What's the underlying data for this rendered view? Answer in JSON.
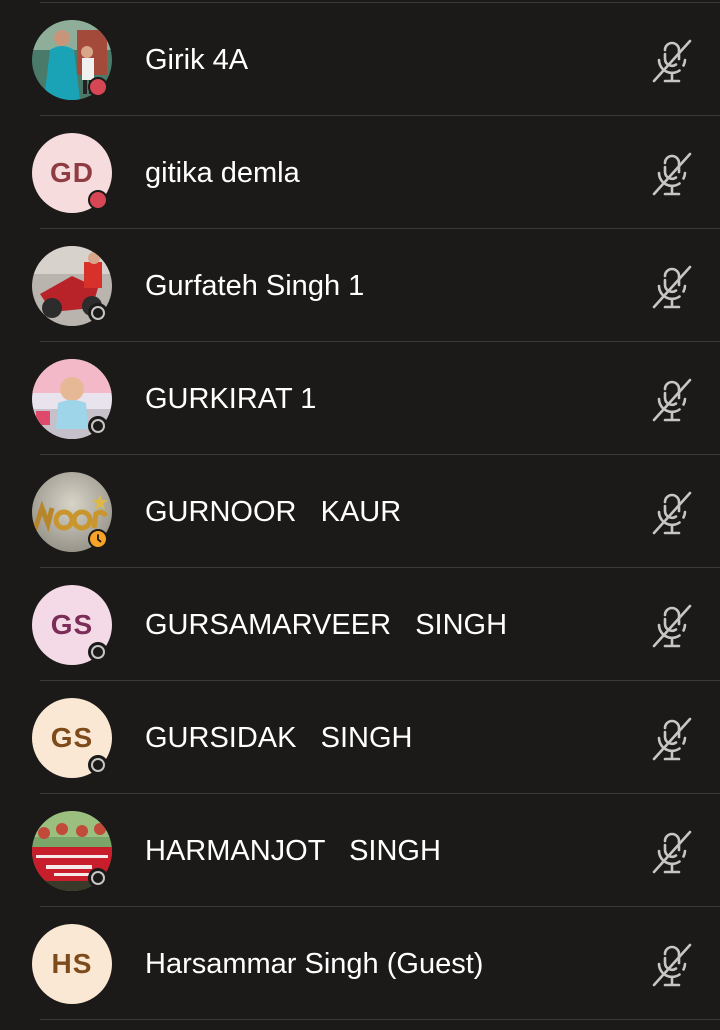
{
  "participants": [
    {
      "name": "Girik 4A",
      "initials": "",
      "avatar_type": "photo",
      "photo_theme": "family-teal",
      "status": "busy",
      "mic": "muted"
    },
    {
      "name": "gitika demla",
      "initials": "GD",
      "avatar_type": "initials",
      "avatar_bg": "#f6dcdc",
      "avatar_fg": "#8e3b44",
      "status": "busy",
      "mic": "muted"
    },
    {
      "name": "Gurfateh Singh 1",
      "initials": "",
      "avatar_type": "photo",
      "photo_theme": "red-motorbike",
      "status": "offline",
      "mic": "muted"
    },
    {
      "name": "GURKIRAT 1",
      "initials": "",
      "avatar_type": "photo",
      "photo_theme": "baby-pink",
      "status": "offline",
      "mic": "muted"
    },
    {
      "name": "GURNOOR   KAUR",
      "initials": "",
      "avatar_type": "photo",
      "photo_theme": "noor-gold-text",
      "status": "away",
      "mic": "muted"
    },
    {
      "name": "GURSAMARVEER   SINGH",
      "initials": "GS",
      "avatar_type": "initials",
      "avatar_bg": "#f4d9e6",
      "avatar_fg": "#7b2d57",
      "status": "offline",
      "mic": "muted"
    },
    {
      "name": "GURSIDAK   SINGH",
      "initials": "GS",
      "avatar_type": "initials",
      "avatar_bg": "#fbe8d4",
      "avatar_fg": "#7d4a1b",
      "status": "offline",
      "mic": "muted"
    },
    {
      "name": "HARMANJOT   SINGH",
      "initials": "",
      "avatar_type": "photo",
      "photo_theme": "farmworkers-banner",
      "status": "offline",
      "mic": "muted"
    },
    {
      "name": "Harsammar Singh (Guest)",
      "initials": "HS",
      "avatar_type": "initials",
      "avatar_bg": "#fbe8d4",
      "avatar_fg": "#7d4a1b",
      "status": "none",
      "mic": "muted"
    }
  ],
  "icons": {
    "mic_muted": "microphone-off-icon",
    "status_busy": "busy-status-icon",
    "status_offline": "offline-status-icon",
    "status_away": "away-clock-status-icon"
  },
  "colors": {
    "background": "#1b1a19",
    "divider": "#3a3938",
    "text": "#ffffff",
    "icon": "#c8c6c4",
    "busy": "#d74654",
    "away": "#f8a328"
  }
}
